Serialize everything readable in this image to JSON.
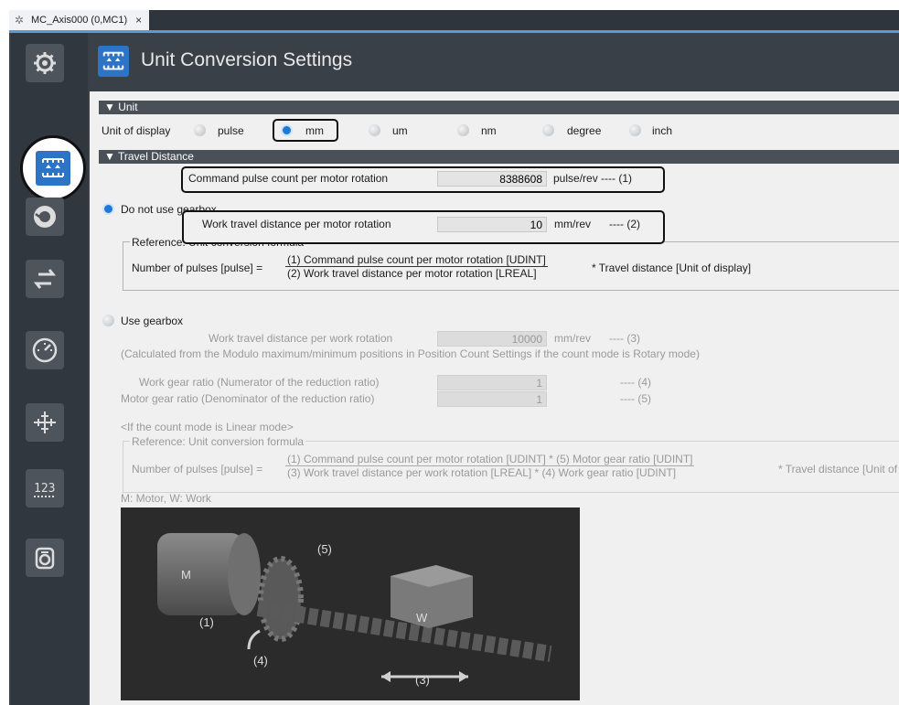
{
  "tab": {
    "title": "MC_Axis000 (0,MC1)",
    "close": "×"
  },
  "header": {
    "title": "Unit Conversion Settings"
  },
  "sidebar": {
    "items": [
      {
        "icon": "axis-basic-settings-icon"
      },
      {
        "icon": "unit-conversion-icon",
        "selected": true
      },
      {
        "icon": "operation-settings-icon"
      },
      {
        "icon": "other-operation-icon"
      },
      {
        "icon": "limit-settings-icon"
      },
      {
        "icon": "position-count-icon"
      },
      {
        "icon": "servo-drive-settings-icon"
      },
      {
        "icon": "homing-settings-icon"
      }
    ]
  },
  "unit": {
    "section": "▼ Unit",
    "display_label": "Unit of display",
    "options": [
      "pulse",
      "mm",
      "um",
      "nm",
      "degree",
      "inch"
    ],
    "selected": "mm"
  },
  "travel": {
    "section": "▼ Travel Distance",
    "cmd_pulse_label": "Command pulse count per motor rotation",
    "cmd_pulse_value": "8388608",
    "cmd_pulse_unit": "pulse/rev ---- (1)",
    "no_gearbox_label": "Do not use gearbox",
    "work_dist_label": "Work travel distance per motor rotation",
    "work_dist_value": "10",
    "work_dist_unit": "mm/rev",
    "work_dist_ref": "---- (2)",
    "ref_legend": "Reference: Unit conversion formula",
    "formula1_lhs": "Number of pulses [pulse] =",
    "formula1_num": "(1) Command pulse count per motor rotation [UDINT]",
    "formula1_den": "(2) Work travel distance per motor rotation [LREAL]",
    "formula1_rhs": "* Travel distance [Unit of display]"
  },
  "gearbox": {
    "label": "Use gearbox",
    "work_rot_label": "Work travel distance per work rotation",
    "work_rot_value": "10000",
    "work_rot_unit": "mm/rev",
    "work_rot_ref": "---- (3)",
    "calc_note": "(Calculated from the Modulo maximum/minimum positions in Position Count Settings if the count mode is Rotary mode)",
    "work_gear_label": "Work gear ratio (Numerator of the reduction ratio)",
    "work_gear_value": "1",
    "work_gear_ref": "---- (4)",
    "motor_gear_label": "Motor gear ratio (Denominator of the reduction ratio)",
    "motor_gear_value": "1",
    "motor_gear_ref": "---- (5)",
    "linear_note": "<If the count mode is Linear mode>",
    "ref_legend": "Reference: Unit conversion formula",
    "formula2_lhs": "Number of pulses [pulse] =",
    "formula2_num": "(1) Command pulse count per motor rotation [UDINT] * (5) Motor gear ratio [UDINT]",
    "formula2_den": "(3) Work travel distance per work rotation [LREAL] * (4) Work gear ratio [UDINT]",
    "formula2_rhs": "* Travel distance [Unit of display]",
    "legend_note": "M: Motor, W: Work"
  },
  "diagram": {
    "motor": "M",
    "work": "W",
    "l1": "(1)",
    "l2": "(4)",
    "l3": "(3)",
    "l5": "(5)"
  }
}
